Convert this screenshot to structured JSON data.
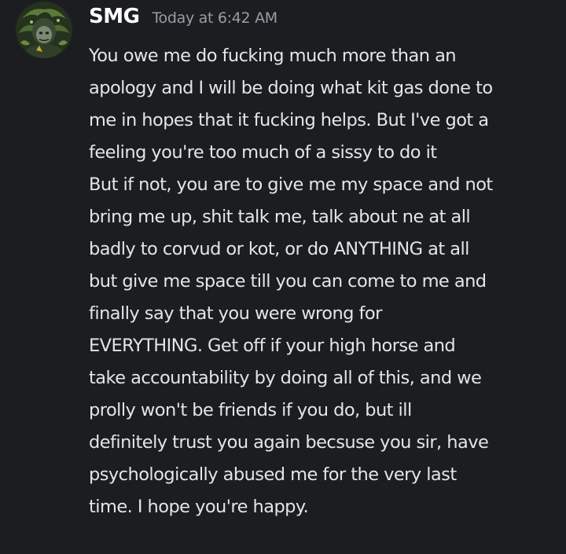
{
  "message": {
    "username": "SMG",
    "timestamp": "Today at 6:42 AM",
    "avatar_icon": "user-avatar-icon",
    "lines": [
      "You owe me do fucking much more than an",
      "apology and I will be doing what kit gas done to",
      "me in hopes that it fucking helps. But I've got a",
      "feeling you're too much of a sissy to do it",
      "But if not, you are to give me my space and not",
      "bring me up, shit talk me, talk about ne at all",
      "badly to corvud or kot, or do ANYTHING at all",
      "but give me space till you can come to me and",
      "finally say that you were wrong for",
      "EVERYTHING. Get off if your high horse and",
      "take accountability by doing all of this, and we",
      "prolly won't be friends if you do, but ill",
      "definitely trust you again becsuse you sir, have",
      "psychologically abused me for the very last",
      "time. I hope you're happy."
    ]
  },
  "colors": {
    "background": "#1c1d21",
    "username": "#ffffff",
    "timestamp": "#9a9ca3",
    "text": "#e4e5e9"
  }
}
